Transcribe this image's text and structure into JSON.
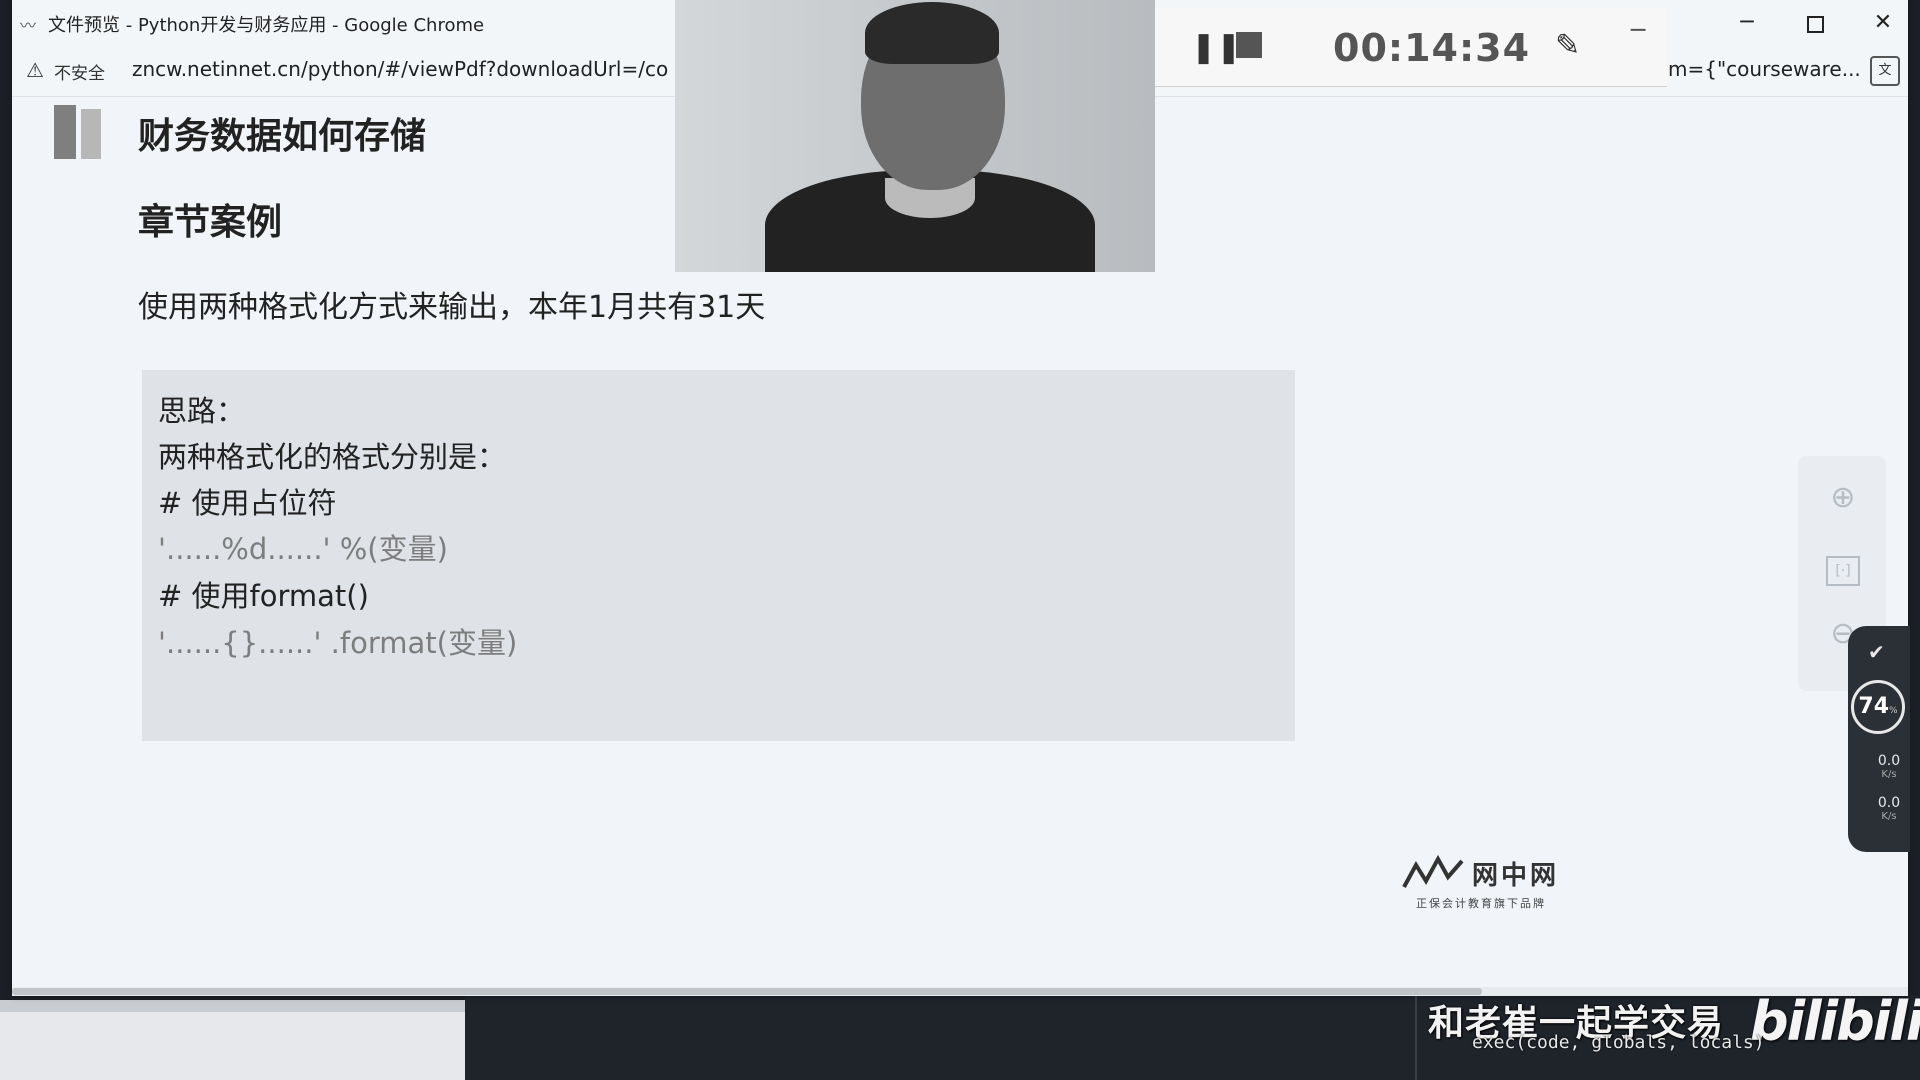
{
  "browser": {
    "window_title": "文件预览 - Python开发与财务应用 - Google Chrome",
    "security_label": "不安全",
    "url_visible_left": "zncw.netinnet.cn/python/#/viewPdf?downloadUrl=/co",
    "url_visible_right": "m={\"courseware...",
    "min_icon": "─",
    "close_icon": "✕"
  },
  "recorder": {
    "elapsed": "00:14:34",
    "pause_icon": "❚❚",
    "brush_icon": "✎",
    "min_icon": "─"
  },
  "document": {
    "section_title": "财务数据如何存储",
    "case_title": "章节案例",
    "task": "使用两种格式化方式来输出，本年1月共有31天",
    "idea_lines": [
      {
        "text": "思路："
      },
      {
        "text": "两种格式化的格式分别是："
      },
      {
        "text": "# 使用占位符"
      },
      {
        "text": "'......%d......' %(变量)"
      },
      {
        "text": "# 使用format()"
      },
      {
        "text": "'......{}......' .format(变量)"
      }
    ],
    "logo_name": "网中网",
    "logo_slogan": "正保会计教育旗下品牌"
  },
  "pdf_tools": {
    "zoom_in_icon": "⊕",
    "fit_icon": "[·]",
    "zoom_out_icon": "⊖"
  },
  "system_monitor": {
    "shield_icon": "✔",
    "cpu_percent": "74",
    "cpu_unit": "%",
    "upload_rate": "0.0",
    "download_rate": "0.0",
    "rate_unit": "K/s"
  },
  "overlay": {
    "watermark": "和老崔一起学交易",
    "bilibili_logo": "bilibili",
    "code_line": "exec(code, globals, locals)"
  }
}
